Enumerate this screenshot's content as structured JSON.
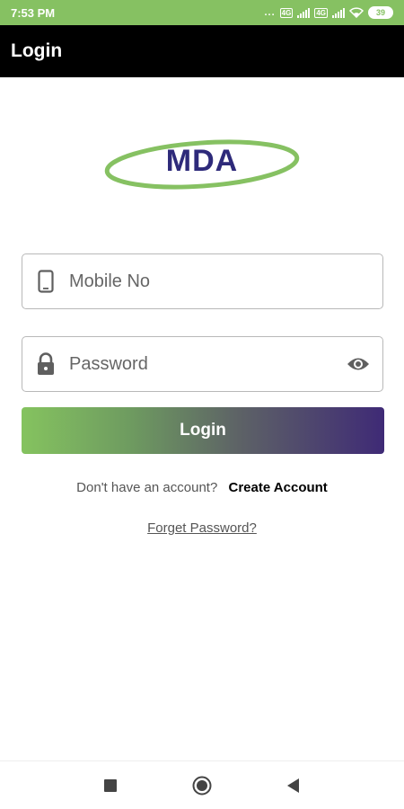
{
  "status_bar": {
    "time": "7:53 PM",
    "dots": "...",
    "sim1": "4G",
    "sim2": "4G",
    "battery": "39",
    "icons": [
      "signal-icon",
      "wifi-icon",
      "battery-icon"
    ]
  },
  "app_bar": {
    "title": "Login"
  },
  "logo": {
    "text": "MDA",
    "ring_color": "#86c162",
    "text_color": "#2e2a7a"
  },
  "form": {
    "mobile": {
      "placeholder": "Mobile No",
      "value": "",
      "icon": "phone-icon"
    },
    "password": {
      "placeholder": "Password",
      "value": "",
      "icon": "lock-icon",
      "toggle_icon": "eye-icon"
    },
    "login_label": "Login"
  },
  "signup": {
    "prompt": "Don't have an account?",
    "link": "Create Account"
  },
  "forget_password": "Forget Password?",
  "nav_bar": {
    "icons": [
      "recents-icon",
      "home-icon",
      "back-icon"
    ]
  },
  "colors": {
    "status_bar": "#86c162",
    "app_bar": "#000000",
    "gradient_start": "#85c35f",
    "gradient_end": "#3f2a76"
  }
}
